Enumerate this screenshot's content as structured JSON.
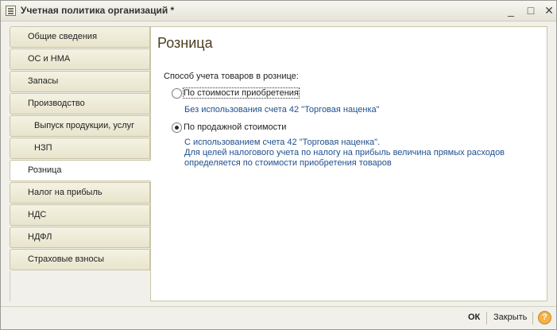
{
  "window": {
    "title": "Учетная политика организаций *",
    "controls": {
      "minimize": "_",
      "maximize": "□",
      "close": "✕"
    }
  },
  "sidebar": {
    "items": [
      {
        "label": "Общие сведения",
        "sub": false,
        "active": false
      },
      {
        "label": "ОС и НМА",
        "sub": false,
        "active": false
      },
      {
        "label": "Запасы",
        "sub": false,
        "active": false
      },
      {
        "label": "Производство",
        "sub": false,
        "active": false
      },
      {
        "label": "Выпуск продукции, услуг",
        "sub": true,
        "active": false
      },
      {
        "label": "НЗП",
        "sub": true,
        "active": false
      },
      {
        "label": "Розница",
        "sub": false,
        "active": true
      },
      {
        "label": "Налог на прибыль",
        "sub": false,
        "active": false
      },
      {
        "label": "НДС",
        "sub": false,
        "active": false
      },
      {
        "label": "НДФЛ",
        "sub": false,
        "active": false
      },
      {
        "label": "Страховые взносы",
        "sub": false,
        "active": false
      }
    ]
  },
  "main": {
    "title": "Розница",
    "field_label": "Способ учета товаров в рознице:",
    "options": [
      {
        "label": "По стоимости приобретения",
        "checked": false,
        "hint_lines": [
          "Без использования счета 42 \"Торговая наценка\""
        ]
      },
      {
        "label": "По продажной стоимости",
        "checked": true,
        "hint_lines": [
          "С использованием счета 42 \"Торговая наценка\".",
          "Для целей налогового учета по налогу на прибыль величина прямых расходов",
          "определяется по стоимости приобретения товаров"
        ]
      }
    ]
  },
  "footer": {
    "ok_label": "ОК",
    "close_label": "Закрыть",
    "help_label": "?"
  }
}
